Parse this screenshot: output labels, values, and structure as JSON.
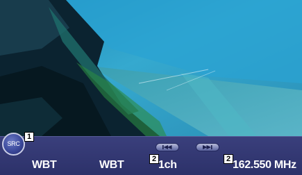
{
  "source_button": {
    "label": "SRC",
    "icon": "src-circle-icon"
  },
  "callouts": {
    "src": "1",
    "seek_prev": "2",
    "seek_next": "2"
  },
  "seek": {
    "prev_icon": "skip-previous-icon",
    "next_icon": "skip-next-icon"
  },
  "status": {
    "title_left": "WBT",
    "title_center": "WBT",
    "channel": "1ch",
    "frequency": "162.550 MHz"
  },
  "colors": {
    "bar": "#2f346d",
    "accent": "#6a79c5",
    "video_sky": "#2a9fc8"
  }
}
